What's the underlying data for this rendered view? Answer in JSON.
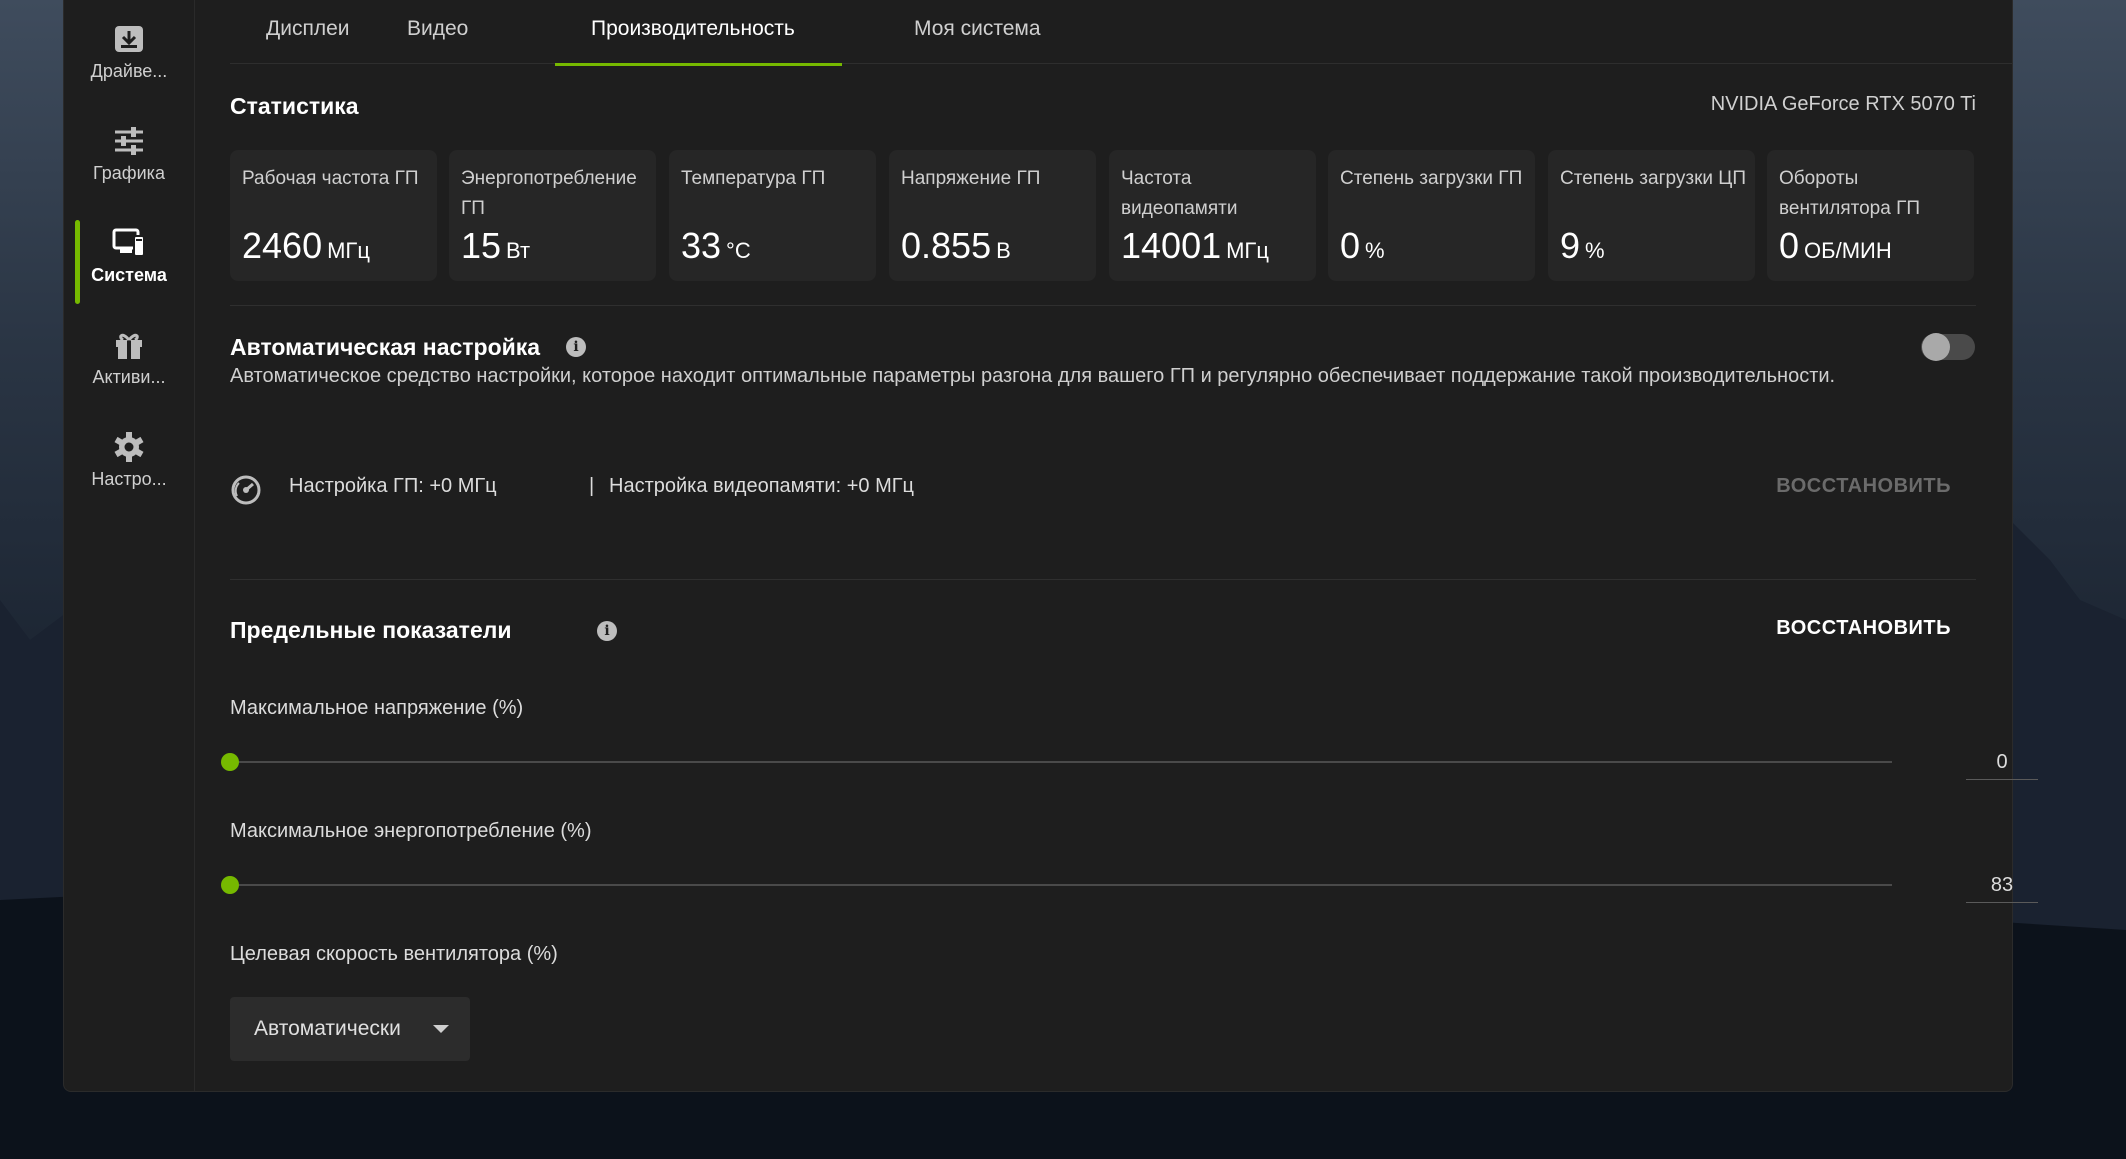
{
  "sidebar": {
    "items": [
      {
        "label": "Драйве...",
        "icon": "download-icon"
      },
      {
        "label": "Графика",
        "icon": "sliders-icon"
      },
      {
        "label": "Система",
        "icon": "system-monitor-icon",
        "active": true
      },
      {
        "label": "Активи...",
        "icon": "gift-icon"
      },
      {
        "label": "Настро...",
        "icon": "gear-icon"
      }
    ]
  },
  "tabs": [
    {
      "label": "Дисплеи"
    },
    {
      "label": "Видео"
    },
    {
      "label": "Производительность",
      "active": true
    },
    {
      "label": "Моя система"
    }
  ],
  "stats": {
    "title": "Статистика",
    "gpu_name": "NVIDIA GeForce RTX 5070 Ti",
    "cards": [
      {
        "label": "Рабочая частота ГП",
        "value": "2460",
        "unit": "МГц"
      },
      {
        "label": "Энергопотребление ГП",
        "value": "15",
        "unit": "Вт"
      },
      {
        "label": "Температура ГП",
        "value": "33",
        "unit": "°C"
      },
      {
        "label": "Напряжение ГП",
        "value": "0.855",
        "unit": "В"
      },
      {
        "label": "Частота видеопамяти",
        "value": "14001",
        "unit": "МГц"
      },
      {
        "label": "Степень загрузки ГП",
        "value": "0",
        "unit": "%"
      },
      {
        "label": "Степень загрузки ЦП",
        "value": "9",
        "unit": "%"
      },
      {
        "label": "Обороты вентилятора ГП",
        "value": "0",
        "unit": "ОБ/МИН"
      }
    ]
  },
  "auto_tune": {
    "title": "Автоматическая настройка",
    "description": "Автоматическое средство настройки, которое находит оптимальные параметры разгона для вашего ГП и регулярно обеспечивает поддержание такой производительности.",
    "enabled": false,
    "gpu_offset": "Настройка ГП: +0 МГц",
    "separator": "|",
    "mem_offset": "Настройка видеопамяти: +0 МГц",
    "restore_label": "ВОССТАНОВИТЬ"
  },
  "limits": {
    "title": "Предельные показатели",
    "restore_label": "ВОССТАНОВИТЬ",
    "max_voltage": {
      "label": "Максимальное напряжение (%)",
      "value": "0"
    },
    "max_power": {
      "label": "Максимальное энергопотребление (%)",
      "value": "83"
    },
    "fan": {
      "label": "Целевая скорость вентилятора (%)",
      "selected": "Автоматически"
    }
  },
  "colors": {
    "accent": "#76b900",
    "panel": "#1e1e1e",
    "card": "#262626"
  }
}
